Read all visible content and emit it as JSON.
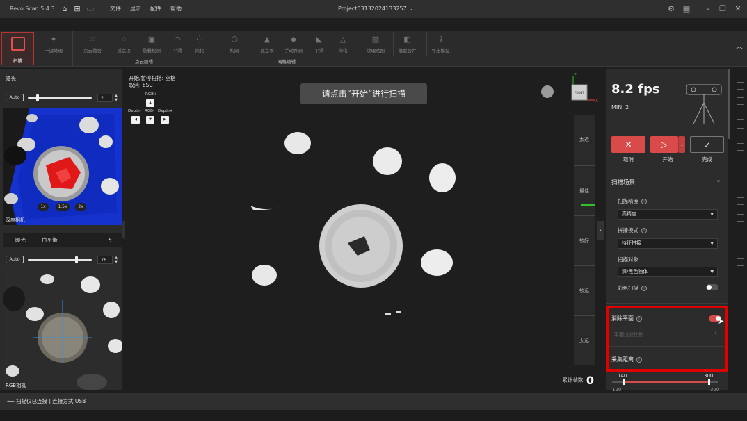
{
  "titlebar": {
    "app_name": "Revo Scan 5.4.3",
    "menus": [
      "文件",
      "显示",
      "配件",
      "帮助"
    ],
    "project": "Project03132024133257"
  },
  "toolbar": {
    "scan_label": "扫描",
    "point_tools": [
      "一键处理",
      "点云融合",
      "孤立项",
      "重叠检测",
      "平滑",
      "简化"
    ],
    "mesh_tools": [
      "构网",
      "孤立项",
      "手动补洞",
      "平滑",
      "简化"
    ],
    "extra_tools": [
      "纹理贴图",
      "模型合并",
      "导出模型"
    ],
    "groups": {
      "point_cloud": "点云编辑",
      "mesh": "网格编辑"
    }
  },
  "left_panel": {
    "exposure_title": "曝光",
    "auto_label": "Auto",
    "depth_exposure_value": "2",
    "depth_label": "深度相机",
    "zoom_options": [
      "1x",
      "1.5x",
      "2x"
    ],
    "tabs": [
      "曝光",
      "白平衡"
    ],
    "rgb_exposure_value": "76",
    "rgb_label": "RGB相机"
  },
  "viewport": {
    "hint_start": "开始/暂停扫描: 空格",
    "hint_cancel": "取消: ESC",
    "key_rgb_plus": "RGB+",
    "key_depth_minus": "Depth-",
    "key_rgb_minus": "RGB-",
    "key_depth_plus": "Depth+",
    "prompt": "请点击“开始”进行扫描",
    "axis_z": "Z",
    "axis_x": "X",
    "view_cube": "FRONT",
    "distance_strip": [
      "太近",
      "最佳",
      "较好",
      "较远",
      "太远"
    ],
    "frame_count_label": "累计帧数:",
    "frame_count": "0"
  },
  "right_panel": {
    "fps": "8.2 fps",
    "device": "MINI 2",
    "cancel": "取消",
    "start": "开始",
    "finish": "完成",
    "scene_title": "扫描场景",
    "precision_label": "扫描精度",
    "precision_value": "高精度",
    "stitch_label": "拼接模式",
    "stitch_value": "特征拼接",
    "target_label": "扫描对象",
    "target_value": "深/黑色物体",
    "color_scan_label": "彩色扫描",
    "color_scan_on": false,
    "remove_plane_label": "消除平面",
    "remove_plane_on": true,
    "plane_ratio_label": "平面过滤比例",
    "distance_label": "采集距离",
    "range_low": "140",
    "range_high": "300",
    "range_min": "120",
    "range_max": "320"
  },
  "status": {
    "text": "扫描仪已连接 | 连接方式 USB"
  },
  "colors": {
    "accent_red": "#d94b4b",
    "highlight_red": "#e00000"
  }
}
